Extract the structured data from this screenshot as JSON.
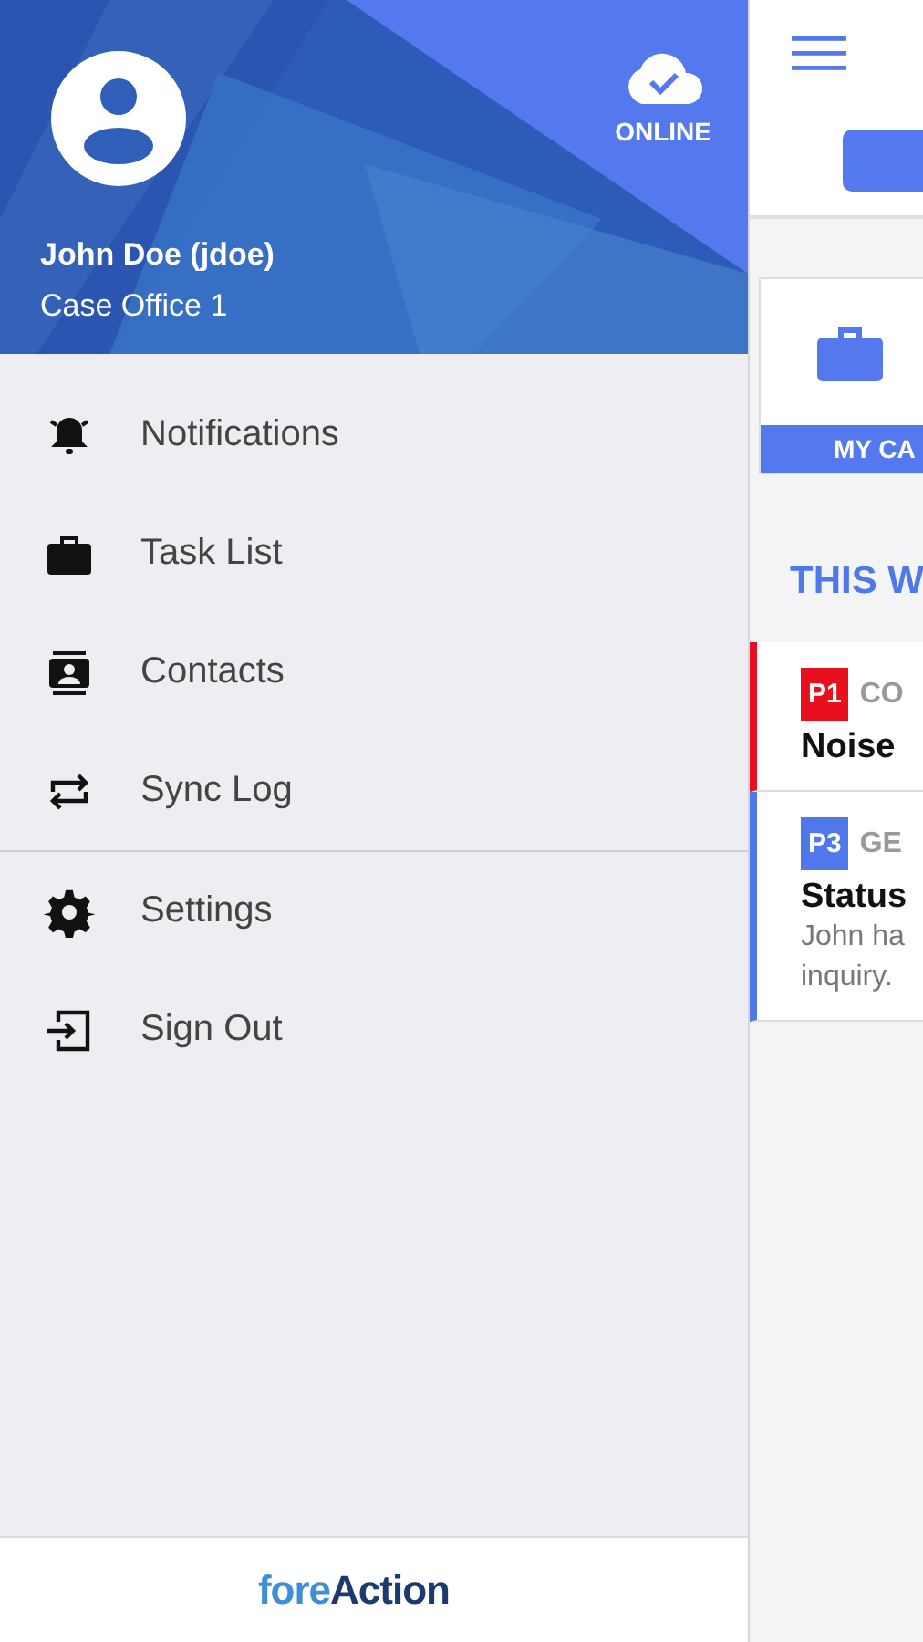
{
  "drawer": {
    "user_name": "John Doe (jdoe)",
    "office": "Case Office 1",
    "status": "ONLINE",
    "menu_groups": [
      [
        {
          "label": "Notifications"
        },
        {
          "label": "Task List"
        },
        {
          "label": "Contacts"
        },
        {
          "label": "Sync Log"
        }
      ],
      [
        {
          "label": "Settings"
        },
        {
          "label": "Sign Out"
        }
      ]
    ],
    "logo": {
      "light": "fore",
      "dark": "Action"
    }
  },
  "main": {
    "tile_label": "MY CA",
    "section_title": "THIS W",
    "cases": [
      {
        "priority": "P1",
        "color": "#e8101e",
        "category": "CO",
        "title": "Noise"
      },
      {
        "priority": "P3",
        "color": "#4f78ea",
        "category": "GE",
        "title": "Status",
        "lines": [
          "John ha",
          "inquiry."
        ]
      }
    ]
  }
}
